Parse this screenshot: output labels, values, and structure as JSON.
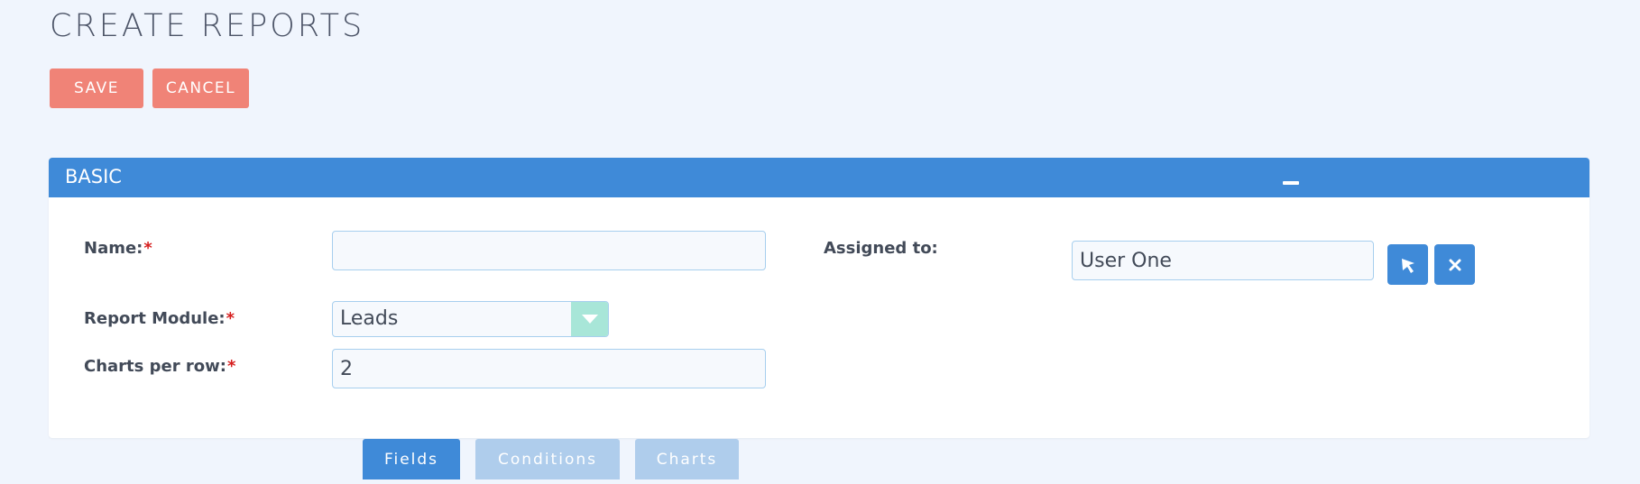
{
  "page": {
    "title": "CREATE REPORTS"
  },
  "actions": {
    "save_label": "SAVE",
    "cancel_label": "CANCEL"
  },
  "panel": {
    "title": "BASIC",
    "collapse_icon": "minus-icon"
  },
  "form": {
    "name": {
      "label": "Name:",
      "required": "*",
      "value": ""
    },
    "report_module": {
      "label": "Report Module:",
      "required": "*",
      "selected": "Leads"
    },
    "charts_per_row": {
      "label": "Charts per row:",
      "required": "*",
      "value": "2"
    },
    "assigned_to": {
      "label": "Assigned to:",
      "value": "User One",
      "select_icon": "cursor-arrow-icon",
      "clear_icon": "close-icon"
    }
  },
  "tabs": [
    {
      "label": "Fields",
      "active": true
    },
    {
      "label": "Conditions",
      "active": false
    },
    {
      "label": "Charts",
      "active": false
    }
  ],
  "colors": {
    "background": "#f0f5fd",
    "action_button": "#f08377",
    "panel_header": "#3f8ad8",
    "tab_active": "#3f8ad8",
    "tab_inactive": "#afcdec",
    "select_arrow": "#a8e6d8",
    "required_marker": "#d61e1e"
  }
}
